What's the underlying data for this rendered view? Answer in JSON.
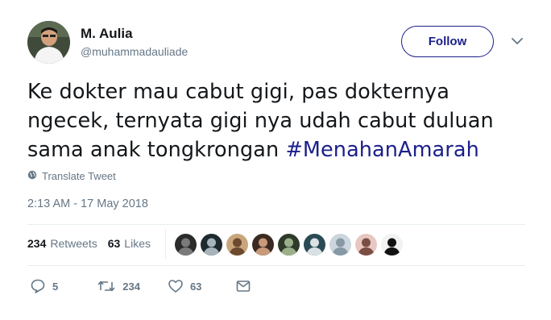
{
  "user": {
    "name": "M. Aulia",
    "handle": "@muhammadauliade"
  },
  "follow_label": "Follow",
  "tweet": {
    "text": "Ke dokter mau cabut gigi, pas dokternya ngecek, ternyata gigi nya udah cabut duluan sama anak tongkrongan ",
    "hashtag": "#MenahanAmarah"
  },
  "translate_label": "Translate Tweet",
  "timestamp": "2:13 AM - 17 May 2018",
  "stats": {
    "retweets_count": "234",
    "retweets_label": "Retweets",
    "likes_count": "63",
    "likes_label": "Likes"
  },
  "likers": [
    {
      "color": "#2b2b2b",
      "accent": "#7a7a7a"
    },
    {
      "color": "#1f2a30",
      "accent": "#a7b4bb"
    },
    {
      "color": "#c9a57c",
      "accent": "#6b4a2f"
    },
    {
      "color": "#3b2a22",
      "accent": "#c99a7a"
    },
    {
      "color": "#2f3a2a",
      "accent": "#9bb08a"
    },
    {
      "color": "#2a4a55",
      "accent": "#d9e1e4"
    },
    {
      "color": "#ccd6dd",
      "accent": "#8899a6"
    },
    {
      "color": "#e8c7c1",
      "accent": "#7a4e45"
    },
    {
      "color": "#f2f2f2",
      "accent": "#111111"
    }
  ],
  "actions": {
    "reply_count": "5",
    "retweet_count": "234",
    "like_count": "63"
  },
  "colors": {
    "brand": "#1b1f8a",
    "secondary_text": "#657786",
    "divider": "#e6ecf0"
  }
}
